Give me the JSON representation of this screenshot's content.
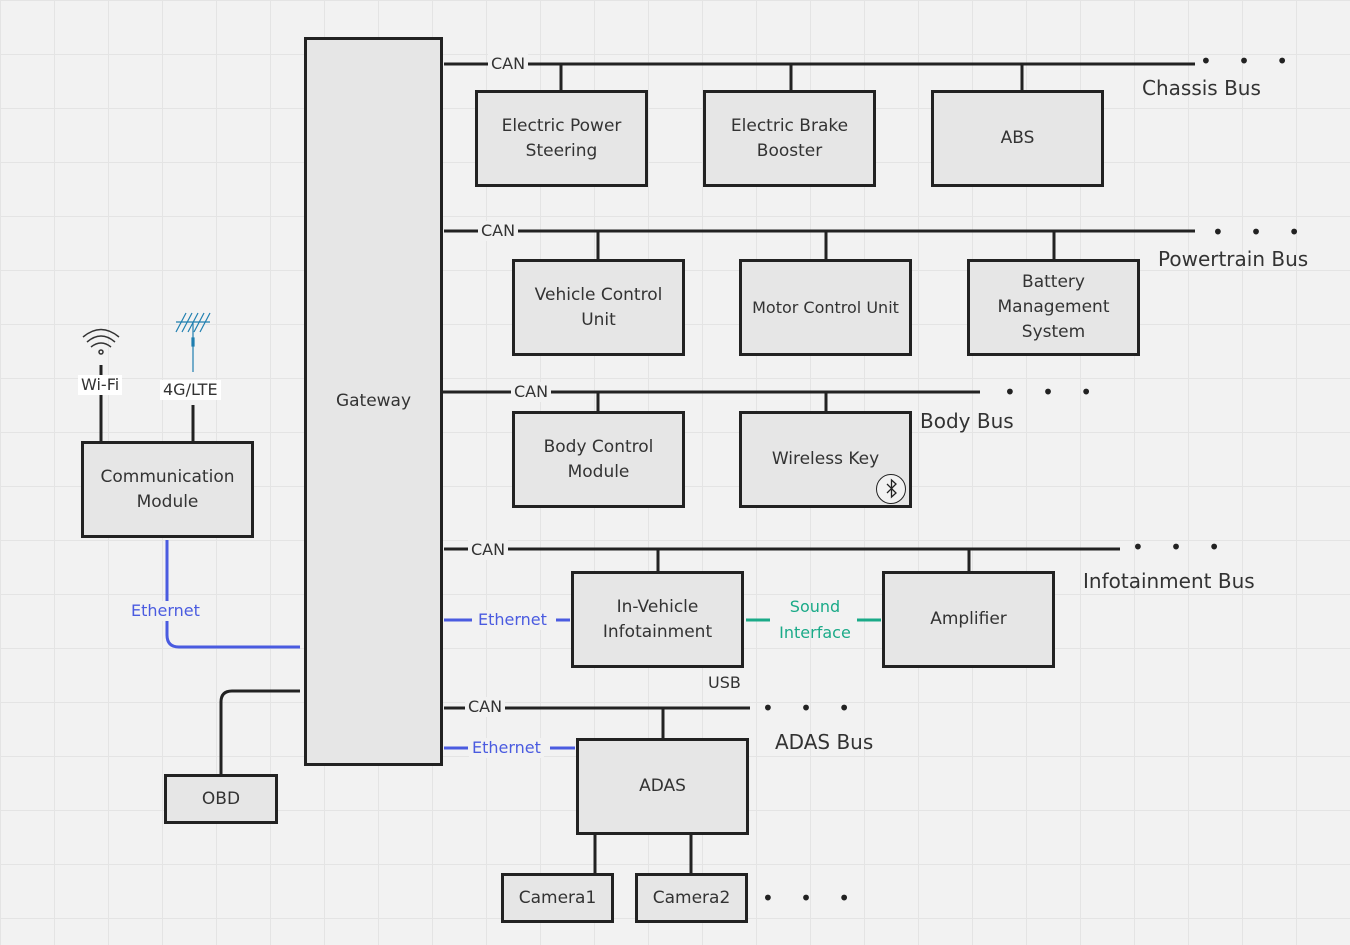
{
  "colors": {
    "line": "#222222",
    "ethernet": "#4a5be0",
    "sound": "#1aaa88",
    "box_fill": "#e6e6e6",
    "antenna": "#1f7fb0"
  },
  "gateway": "Gateway",
  "buses": {
    "chassis": {
      "label": "Chassis Bus",
      "protocol": "CAN",
      "nodes": [
        "Electric Power Steering",
        "Electric Brake Booster",
        "ABS"
      ]
    },
    "powertrain": {
      "label": "Powertrain Bus",
      "protocol": "CAN",
      "nodes": [
        "Vehicle Control Unit",
        "Motor Control Unit",
        "Battery Management System"
      ]
    },
    "body": {
      "label": "Body Bus",
      "protocol": "CAN",
      "nodes": [
        "Body Control Module",
        "Wireless Key"
      ]
    },
    "infotainment": {
      "label": "Infotainment Bus",
      "protocol": "CAN",
      "nodes": [
        "In-Vehicle Infotainment",
        "Amplifier"
      ]
    },
    "adas": {
      "label": "ADAS Bus",
      "protocol": "CAN",
      "nodes": [
        "ADAS"
      ]
    }
  },
  "ellipsis": "• • •",
  "links": {
    "ethernet": "Ethernet",
    "sound": "Sound Interface",
    "usb": "USB"
  },
  "cameras": [
    "Camera1",
    "Camera2"
  ],
  "comm": {
    "label": "Communication Module",
    "wifi": "Wi-Fi",
    "lte": "4G/LTE"
  },
  "obd": "OBD",
  "icons": [
    "wifi-icon",
    "antenna-icon",
    "bluetooth-icon"
  ]
}
